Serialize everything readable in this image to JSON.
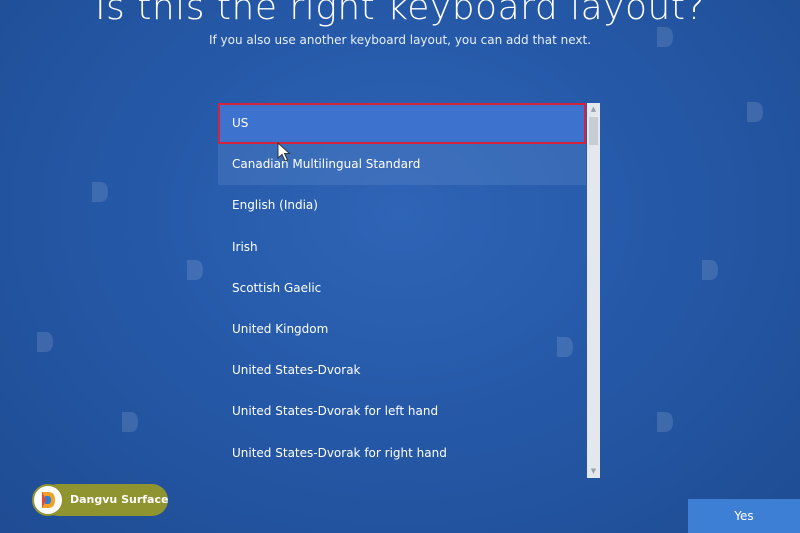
{
  "header": {
    "title": "Is this the right keyboard layout?",
    "subtitle": "If you also use another keyboard layout, you can add that next."
  },
  "layouts": {
    "selected_index": 0,
    "items": [
      "US",
      "Canadian Multilingual Standard",
      "English (India)",
      "Irish",
      "Scottish Gaelic",
      "United Kingdom",
      "United States-Dvorak",
      "United States-Dvorak for left hand",
      "United States-Dvorak for right hand"
    ]
  },
  "footer": {
    "yes_label": "Yes"
  },
  "watermark_logo": {
    "text": "Dangvu Surface"
  },
  "colors": {
    "background": "#2559a8",
    "selected_item": "#3d73cf",
    "selection_outline": "#d4233a",
    "button": "#3e7fd6",
    "logo_pill": "#8f9431"
  },
  "icons": {
    "cursor": "mouse-pointer-icon",
    "scroll_up": "scroll-up-arrow-icon",
    "scroll_down": "scroll-down-arrow-icon",
    "logo": "dangvu-logo-icon"
  }
}
